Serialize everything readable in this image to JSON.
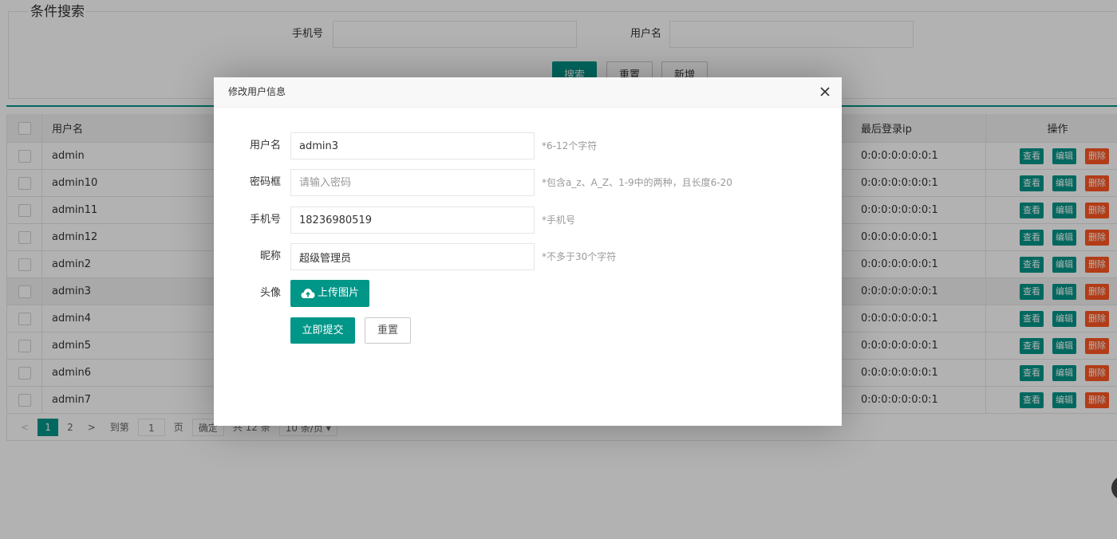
{
  "search": {
    "legend": "条件搜索",
    "phone_label": "手机号",
    "username_label": "用户名",
    "search_btn": "搜索",
    "reset_btn": "重置",
    "add_btn": "新增"
  },
  "table": {
    "headers": {
      "username": "用户名",
      "last_ip": "最后登录ip",
      "ops": "操作"
    },
    "rows": [
      {
        "username": "admin",
        "ip": "0:0:0:0:0:0:0:1"
      },
      {
        "username": "admin10",
        "ip": "0:0:0:0:0:0:0:1"
      },
      {
        "username": "admin11",
        "ip": "0:0:0:0:0:0:0:1"
      },
      {
        "username": "admin12",
        "ip": "0:0:0:0:0:0:0:1"
      },
      {
        "username": "admin2",
        "ip": "0:0:0:0:0:0:0:1"
      },
      {
        "username": "admin3",
        "ip": "0:0:0:0:0:0:0:1"
      },
      {
        "username": "admin4",
        "ip": "0:0:0:0:0:0:0:1"
      },
      {
        "username": "admin5",
        "ip": "0:0:0:0:0:0:0:1"
      },
      {
        "username": "admin6",
        "ip": "0:0:0:0:0:0:0:1"
      },
      {
        "username": "admin7",
        "ip": "0:0:0:0:0:0:0:1"
      }
    ],
    "actions": {
      "view": "查看",
      "edit": "编辑",
      "delete": "删除"
    }
  },
  "pager": {
    "prev": "<",
    "page1": "1",
    "page2": "2",
    "next": ">",
    "goto_label": "到第",
    "goto_value": "1",
    "page_unit": "页",
    "confirm": "确定",
    "total": "共 12 条",
    "page_size": "10 条/页"
  },
  "modal": {
    "title": "修改用户信息",
    "fields": {
      "username": {
        "label": "用户名",
        "value": "admin3",
        "tip": "*6-12个字符"
      },
      "password": {
        "label": "密码框",
        "placeholder": "请输入密码",
        "tip": "*包含a_z、A_Z、1-9中的两种，且长度6-20"
      },
      "phone": {
        "label": "手机号",
        "value": "18236980519",
        "tip": "*手机号"
      },
      "nickname": {
        "label": "昵称",
        "value": "超级管理员",
        "tip": "*不多于30个字符"
      },
      "avatar": {
        "label": "头像",
        "upload_btn": "上传图片"
      }
    },
    "submit_btn": "立即提交",
    "reset_btn": "重置"
  },
  "colors": {
    "primary": "#009688",
    "danger": "#ff5722"
  }
}
